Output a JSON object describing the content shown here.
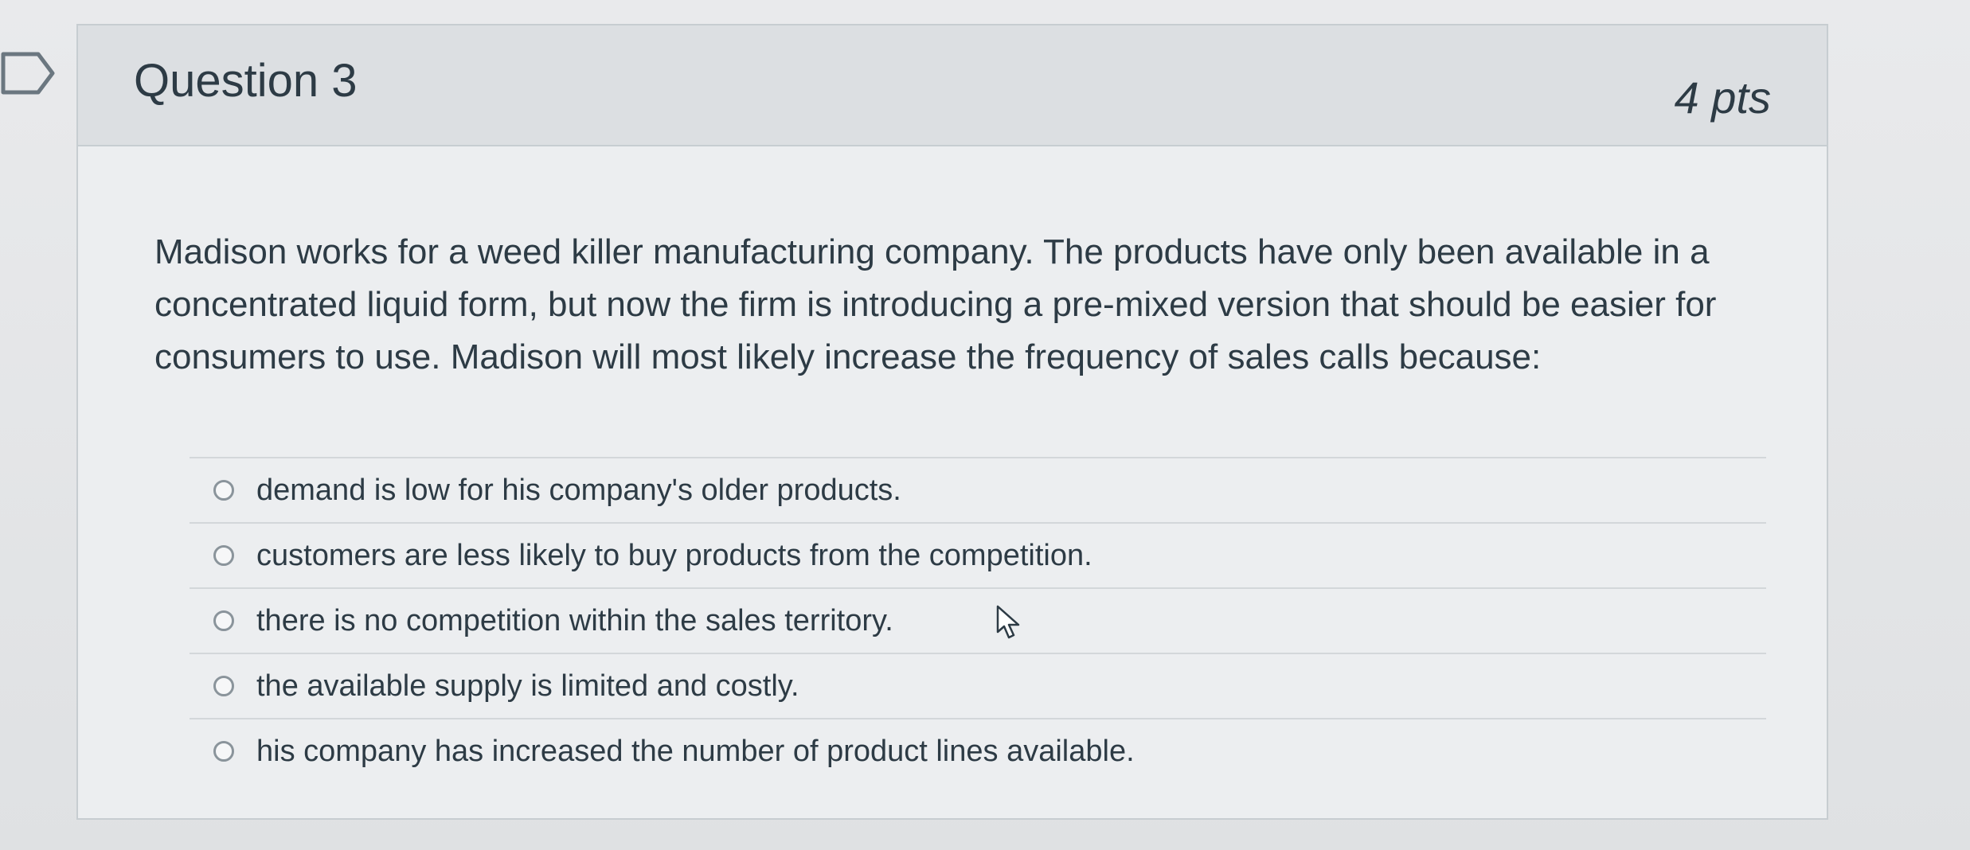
{
  "question": {
    "title": "Question 3",
    "points": "4 pts",
    "text": "Madison works for a weed killer manufacturing company. The products have only been available in a concentrated liquid form, but now the firm is introducing a pre-mixed version that should be easier for consumers to use. Madison will most likely increase the frequency of sales calls because:",
    "answers": [
      "demand is low for his company's older products.",
      "customers are less likely to buy products from the competition.",
      "there is no competition within the sales territory.",
      "the available supply is limited and costly.",
      "his company has increased the number of product lines available."
    ]
  },
  "icons": {
    "bookmark": "bookmark-icon",
    "cursor": "mouse-cursor-icon"
  }
}
